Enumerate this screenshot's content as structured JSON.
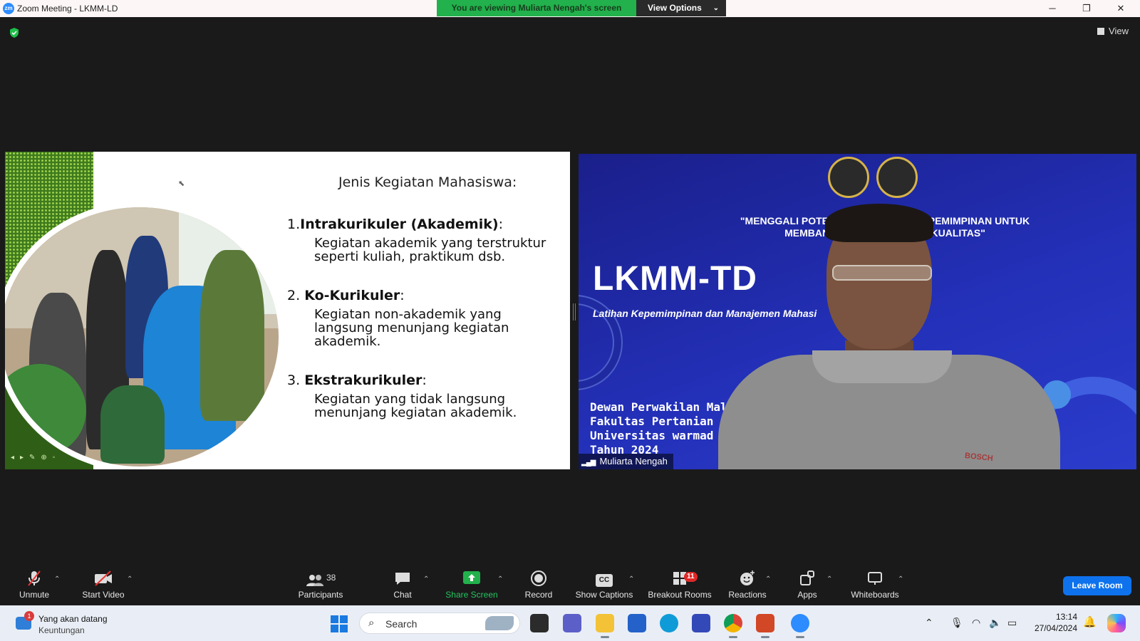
{
  "window": {
    "title": "Zoom Meeting - LKMM-LD",
    "app_icon": "zoom-logo",
    "logo_text": "zm",
    "banner_message": "You are viewing Muliarta Nengah's screen",
    "view_options_label": "View Options",
    "controls": [
      "minimize-icon",
      "restore-icon",
      "close-icon"
    ]
  },
  "stage": {
    "view_label": "View",
    "slide": {
      "title": "Jenis Kegiatan Mahasiswa:",
      "sections": [
        {
          "number": "1.",
          "heading": "Intrakurikuler (Akademik)",
          "suffix": ":",
          "body": [
            "Kegiatan akademik yang terstruktur",
            "seperti   kuliah, praktikum dsb."
          ]
        },
        {
          "number": "2.",
          "heading": "Ko-Kurikuler",
          "suffix": ":",
          "body": [
            "Kegiatan non-akademik yang",
            "langsung menunjang kegiatan",
            "akademik."
          ]
        },
        {
          "number": "3.",
          "heading": "Ekstrakurikuler",
          "suffix": ":",
          "body": [
            "Kegiatan yang  tidak langsung",
            "menunjang kegiatan akademik."
          ]
        }
      ]
    },
    "speaker": {
      "name": "Muliarta Nengah",
      "background_quote_line1": "\"MENGGALI POTENSI MA            AM KEPEMIMPINAN UNTUK",
      "background_quote_line2": "MEMBANGUN                     BERKUALITAS\"",
      "background_title": "LKMM-TD",
      "background_subtitle": "Latihan Kepemimpinan dan Manajemen Mahasi",
      "background_org": "Dewan Perwakilan Mal\nFakultas Pertanian\nUniversitas warmad\nTahun 2024",
      "shirt_logo": "BOSCH"
    }
  },
  "toolbar": {
    "items": [
      {
        "id": "unmute",
        "label": "Unmute",
        "icon": "mic-muted-icon"
      },
      {
        "id": "start-video",
        "label": "Start Video",
        "icon": "video-off-icon"
      },
      {
        "id": "participants",
        "label": "Participants",
        "icon": "participants-icon",
        "count": "38"
      },
      {
        "id": "chat",
        "label": "Chat",
        "icon": "chat-icon"
      },
      {
        "id": "share-screen",
        "label": "Share Screen",
        "icon": "share-screen-icon"
      },
      {
        "id": "record",
        "label": "Record",
        "icon": "record-icon"
      },
      {
        "id": "show-captions",
        "label": "Show Captions",
        "icon": "captions-icon",
        "icon_text": "CC"
      },
      {
        "id": "breakout-rooms",
        "label": "Breakout Rooms",
        "icon": "breakout-rooms-icon",
        "badge": "11"
      },
      {
        "id": "reactions",
        "label": "Reactions",
        "icon": "reactions-icon"
      },
      {
        "id": "apps",
        "label": "Apps",
        "icon": "apps-icon"
      },
      {
        "id": "whiteboards",
        "label": "Whiteboards",
        "icon": "whiteboard-icon"
      }
    ],
    "leave_label": "Leave Room",
    "colors": {
      "share_green": "#22b14c",
      "leave_blue": "#0e72ed",
      "badge_red": "#e02828"
    }
  },
  "taskbar": {
    "widget": {
      "badge": "1",
      "line1": "Yang akan datang",
      "line2": "Keuntungan"
    },
    "search_placeholder": "Search",
    "apps": [
      "windows-start-icon",
      "task-view-icon",
      "teams-icon",
      "file-explorer-icon",
      "store-icon",
      "edge-icon",
      "whiteboard-app-icon",
      "chrome-icon",
      "powerpoint-icon",
      "zoom-app-icon"
    ],
    "time": "13:14",
    "date": "27/04/2024"
  }
}
